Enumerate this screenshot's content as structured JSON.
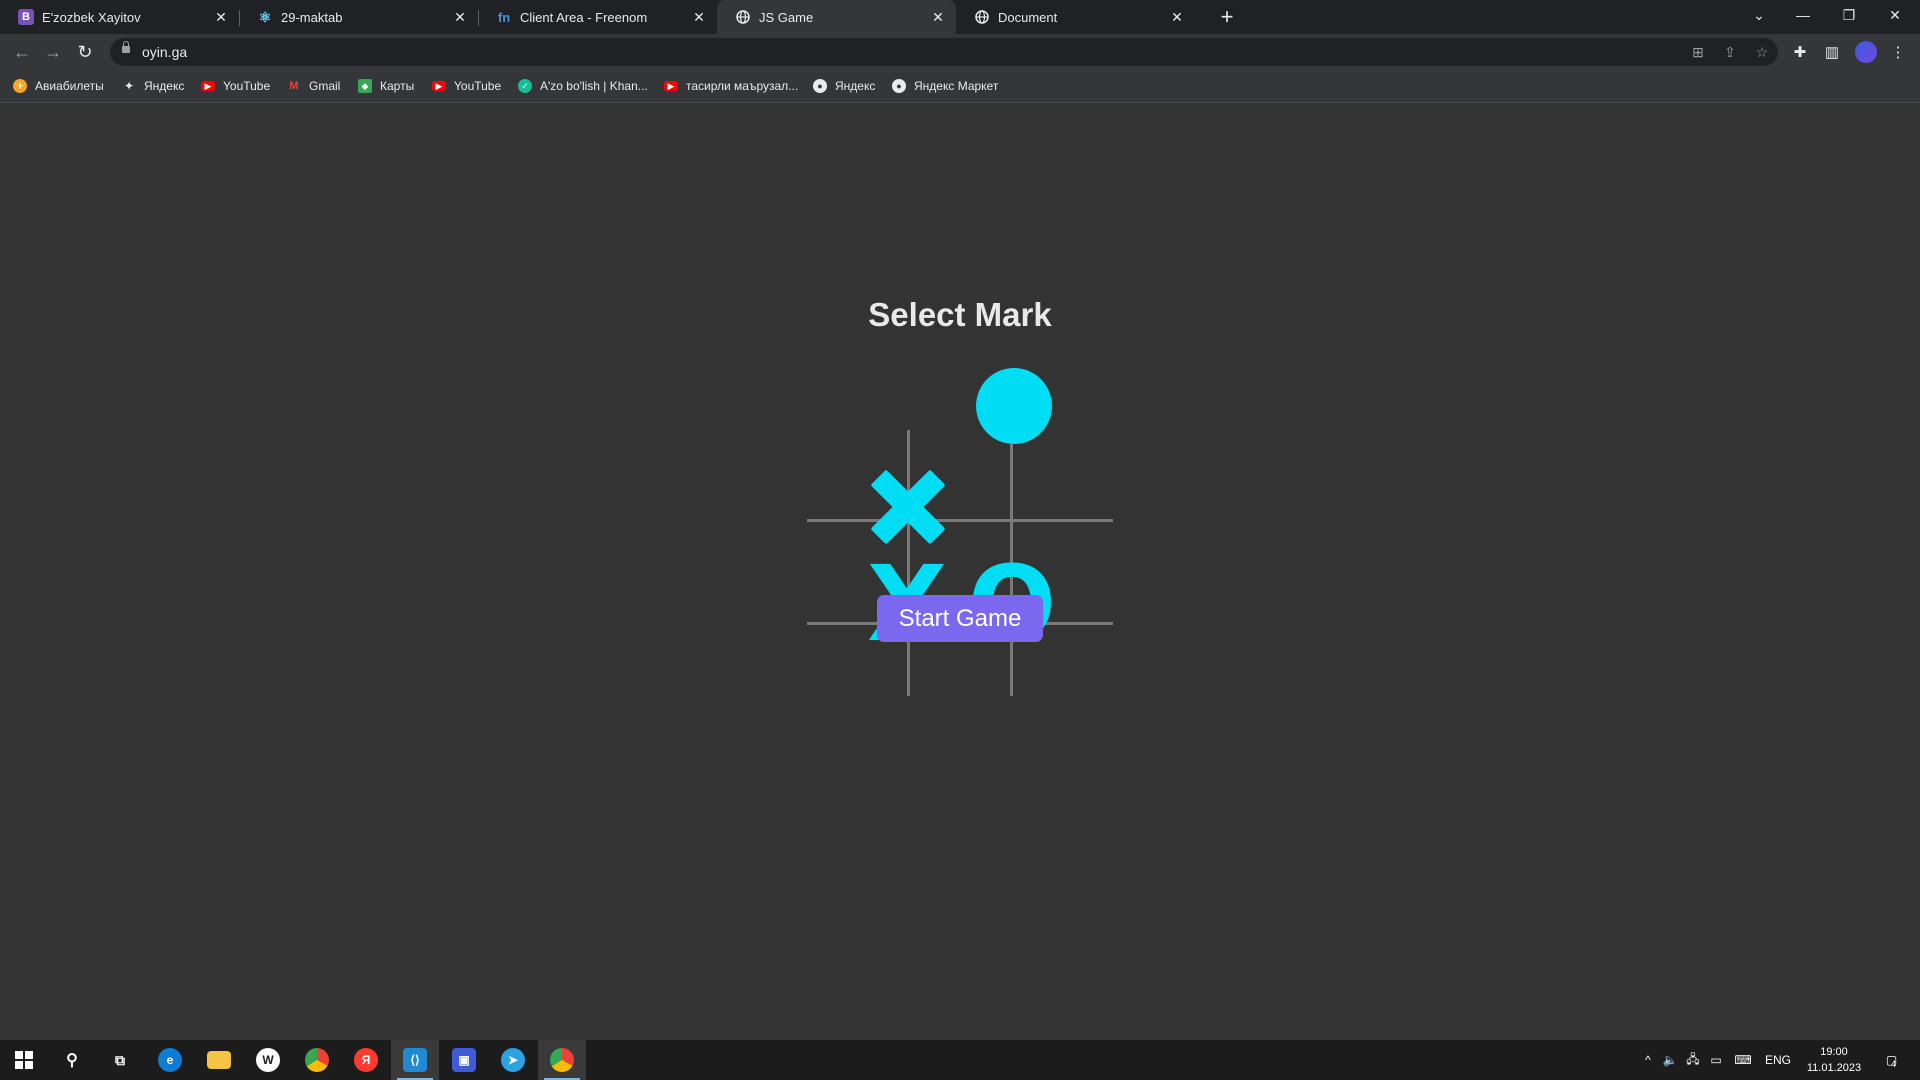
{
  "tabs": [
    {
      "title": "E'zozbek Xayitov",
      "icon": "bootstrap-icon"
    },
    {
      "title": "29-maktab",
      "icon": "react-icon"
    },
    {
      "title": "Client Area - Freenom",
      "icon": "freenom-icon"
    },
    {
      "title": "JS Game",
      "icon": "globe-icon",
      "active": true
    },
    {
      "title": "Document",
      "icon": "globe-icon"
    }
  ],
  "address_bar": {
    "url": "oyin.ga"
  },
  "bookmarks": [
    "Авиабилеты",
    "Яндекс",
    "YouTube",
    "Gmail",
    "Карты",
    "YouTube",
    "A'zo bo'lish | Khan...",
    "тасирли маърузал...",
    "Яндекс",
    "Яндекс Маркет"
  ],
  "game": {
    "heading": "Select Mark",
    "x_letter": "X",
    "o_letter": "O",
    "start_button": "Start Game",
    "accent_color": "#00ddf5",
    "button_color": "#7b68ee"
  },
  "taskbar": {
    "language": "ENG",
    "time": "19:00",
    "date": "11.01.2023",
    "notification_count": "4"
  }
}
